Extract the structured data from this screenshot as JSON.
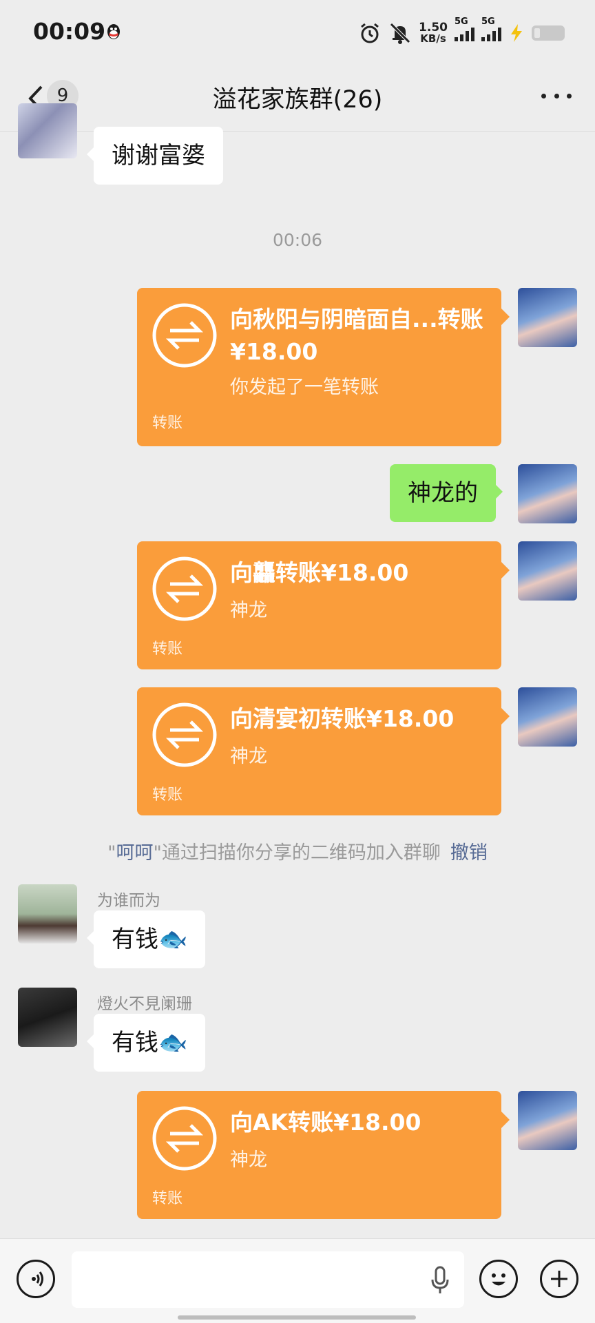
{
  "status_bar": {
    "time": "00:09",
    "net_speed_value": "1.50",
    "net_speed_unit": "KB/s",
    "sim1_label": "5G",
    "sim2_label": "5G"
  },
  "header": {
    "back_badge": "9",
    "title": "溢花家族群(26)"
  },
  "messages": {
    "partial_text": "谢谢富婆",
    "timestamp": "00:06",
    "transfer1": {
      "title": "向秋阳与阴暗面自...转账¥18.00",
      "subtitle": "你发起了一笔转账",
      "footer": "转账"
    },
    "green_text": "神龙的",
    "transfer2": {
      "title": "向龘转账¥18.00",
      "subtitle": "神龙",
      "footer": "转账"
    },
    "transfer3": {
      "title": "向清宴初转账¥18.00",
      "subtitle": "神龙",
      "footer": "转账"
    },
    "system": {
      "quote_open": "\"",
      "name": "呵呵",
      "rest": "\"通过扫描你分享的二维码加入群聊",
      "revoke": "撤销"
    },
    "msg1": {
      "sender": "为谁而为",
      "text": "有钱🐟"
    },
    "msg2": {
      "sender": "燈火不見阑珊",
      "text": "有钱🐟"
    },
    "transfer4": {
      "title": "向AK转账¥18.00",
      "subtitle": "神龙",
      "footer": "转账"
    }
  },
  "colors": {
    "transfer_orange": "#fa9d3b",
    "self_bubble_green": "#95ec69",
    "link_blue": "#576b95",
    "chat_background": "#ededed"
  },
  "icons": [
    "qq-icon",
    "alarm-icon",
    "mute-icon",
    "signal-icon",
    "battery-icon",
    "back-chevron-icon",
    "more-icon",
    "transfer-icon",
    "voice-icon",
    "emoji-icon",
    "plus-icon",
    "mic-icon"
  ]
}
